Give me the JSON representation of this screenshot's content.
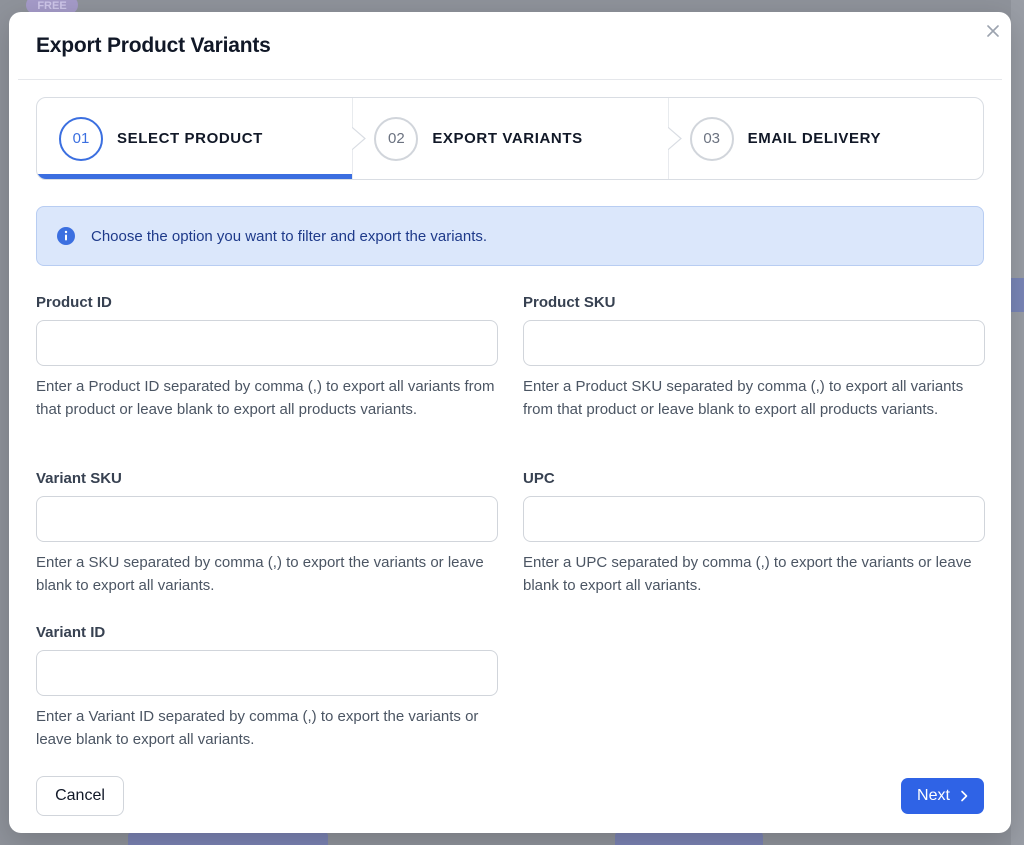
{
  "backdrop": {
    "badge": "FREE"
  },
  "modal": {
    "title": "Export Product Variants",
    "close_icon": "close-icon"
  },
  "stepper": {
    "steps": [
      {
        "number": "01",
        "label": "SELECT PRODUCT",
        "active": true
      },
      {
        "number": "02",
        "label": "EXPORT VARIANTS",
        "active": false
      },
      {
        "number": "03",
        "label": "EMAIL DELIVERY",
        "active": false
      }
    ]
  },
  "alert": {
    "icon": "info-icon",
    "text": "Choose the option you want to filter and export the variants."
  },
  "fields": {
    "product_id": {
      "label": "Product ID",
      "value": "",
      "help": "Enter a Product ID separated by comma (,) to export all variants from that product or leave blank to export all products variants."
    },
    "product_sku": {
      "label": "Product SKU",
      "value": "",
      "help": "Enter a Product SKU separated by comma (,) to export all variants from that product or leave blank to export all products variants."
    },
    "variant_sku": {
      "label": "Variant SKU",
      "value": "",
      "help": "Enter a SKU separated by comma (,) to export the variants or leave blank to export all variants."
    },
    "upc": {
      "label": "UPC",
      "value": "",
      "help": "Enter a UPC separated by comma (,) to export the variants or leave blank to export all variants."
    },
    "variant_id": {
      "label": "Variant ID",
      "value": "",
      "help": "Enter a Variant ID separated by comma (,) to export the variants or leave blank to export all variants."
    }
  },
  "footer": {
    "cancel_label": "Cancel",
    "next_label": "Next",
    "next_icon": "chevron-right-icon"
  },
  "colors": {
    "accent": "#2f63e6",
    "alert_bg": "#dbe7fb",
    "alert_text": "#1e3a8a"
  }
}
